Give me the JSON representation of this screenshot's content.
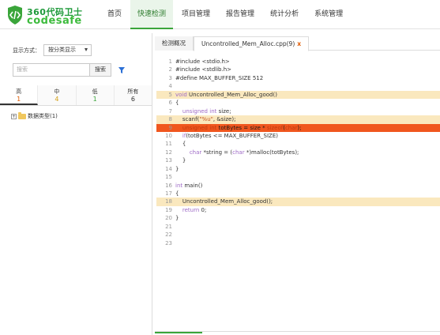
{
  "app": {
    "logo_cn": "360代码卫士",
    "logo_en": "codesafe"
  },
  "nav": {
    "items": [
      {
        "label": "首页",
        "active": false
      },
      {
        "label": "快速检测",
        "active": true
      },
      {
        "label": "项目管理",
        "active": false
      },
      {
        "label": "报告管理",
        "active": false
      },
      {
        "label": "统计分析",
        "active": false
      },
      {
        "label": "系统管理",
        "active": false
      }
    ]
  },
  "sidebar": {
    "display_mode_label": "显示方式：",
    "display_mode_value": "按分类显示",
    "search_placeholder": "搜索",
    "search_button": "搜索",
    "severity_tabs": [
      {
        "label": "高",
        "count": "1",
        "color": "#e05a00"
      },
      {
        "label": "中",
        "count": "4",
        "color": "#d4a017"
      },
      {
        "label": "低",
        "count": "1",
        "color": "#3aa53a"
      },
      {
        "label": "所有",
        "count": "6",
        "color": "#333333"
      }
    ],
    "tree": {
      "toggle": "+",
      "label": "数据类型(1)"
    }
  },
  "tabs": {
    "overview": "检测概况",
    "file": "Uncontrolled_Mem_Alloc.cpp(9)",
    "close": "x"
  },
  "code_lines": [
    {
      "n": "1",
      "text": "#include <stdio.h>"
    },
    {
      "n": "2",
      "text": "#include <stdlib.h>"
    },
    {
      "n": "3",
      "text": "#define MAX_BUFFER_SIZE 512"
    },
    {
      "n": "4",
      "text": ""
    },
    {
      "n": "5",
      "text": "void Uncontrolled_Mem_Alloc_good()"
    },
    {
      "n": "6",
      "text": "{"
    },
    {
      "n": "7",
      "text": "    unsigned int size;"
    },
    {
      "n": "8",
      "text": "    scanf(\"%u\", &size);"
    },
    {
      "n": "9",
      "text": "    unsigned int totBytes = size * sizeof(char);"
    },
    {
      "n": "10",
      "text": "    if(totBytes <= MAX_BUFFER_SIZE)"
    },
    {
      "n": "11",
      "text": "    {"
    },
    {
      "n": "12",
      "text": "        char *string = (char *)malloc(totBytes);"
    },
    {
      "n": "13",
      "text": "    }"
    },
    {
      "n": "14",
      "text": "}"
    },
    {
      "n": "15",
      "text": ""
    },
    {
      "n": "16",
      "text": "int main()"
    },
    {
      "n": "17",
      "text": "{"
    },
    {
      "n": "18",
      "text": "    Uncontrolled_Mem_Alloc_good();"
    },
    {
      "n": "19",
      "text": "    return 0;"
    },
    {
      "n": "20",
      "text": "}"
    },
    {
      "n": "21",
      "text": ""
    },
    {
      "n": "22",
      "text": ""
    },
    {
      "n": "23",
      "text": ""
    }
  ],
  "colors": {
    "accent": "#3aa53a",
    "highlight_line": "#fae8be",
    "error_line": "#f0561e"
  }
}
